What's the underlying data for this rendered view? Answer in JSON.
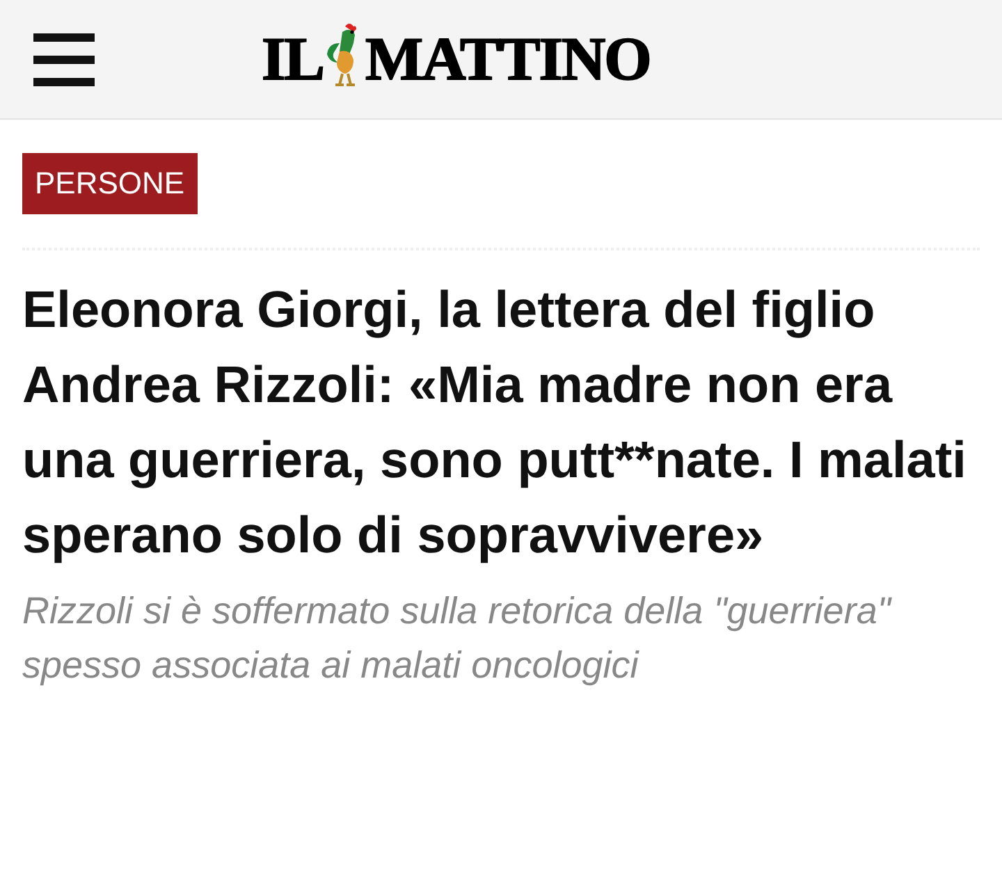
{
  "header": {
    "logo_left": "IL",
    "logo_right": "MATTINO"
  },
  "article": {
    "category": "PERSONE",
    "title": "Eleonora Giorgi, la lettera del figlio Andrea Rizzoli: «Mia madre non era una guerriera, sono putt**nate. I malati sperano solo di sopravvivere»",
    "subtitle": "Rizzoli si è soffermato sulla retorica della \"guerriera\" spesso associata ai malati oncologici"
  }
}
